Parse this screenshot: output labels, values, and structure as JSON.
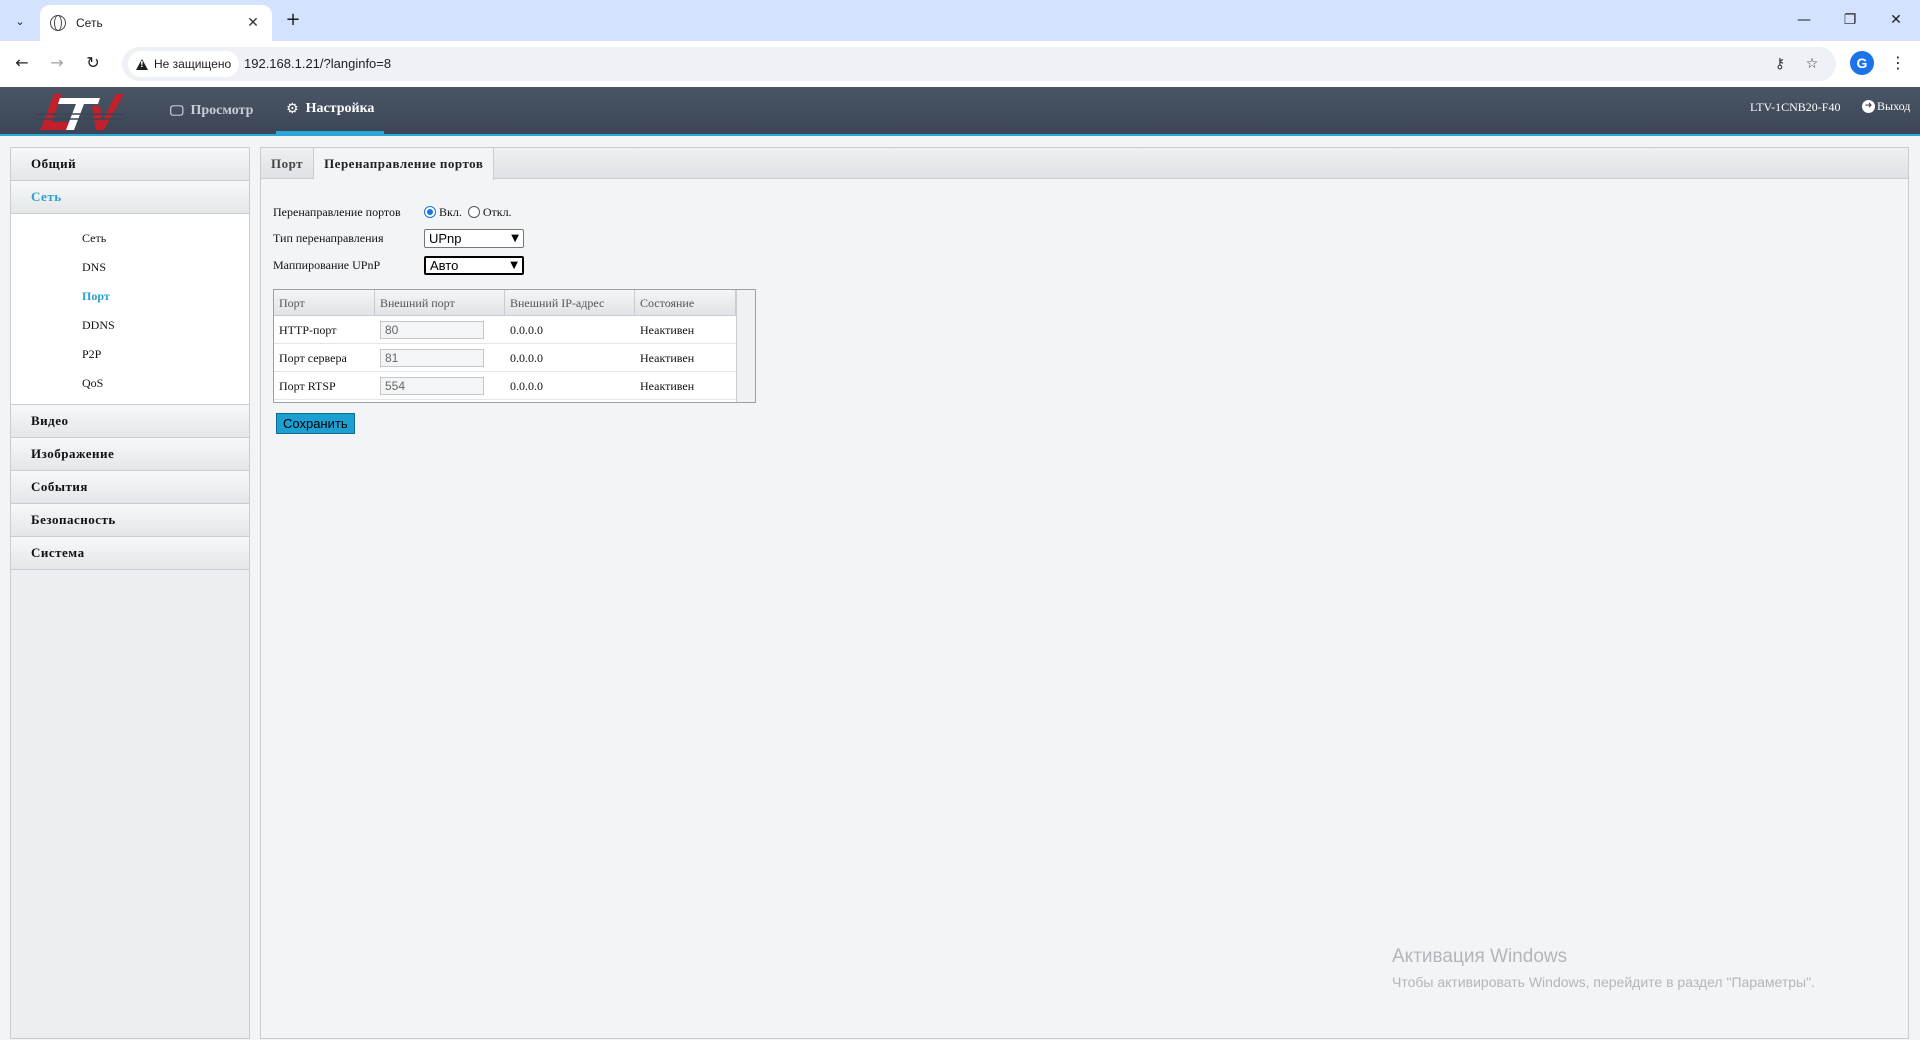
{
  "browser": {
    "tab_title": "Сеть",
    "security_label": "Не защищено",
    "url": "192.168.1.21/?langinfo=8",
    "profile_letter": "G"
  },
  "header": {
    "logo_text": "LTV",
    "nav": [
      {
        "label": "Просмотр",
        "icon": "monitor-icon"
      },
      {
        "label": "Настройка",
        "icon": "gear-icon"
      }
    ],
    "model": "LTV-1CNB20-F40",
    "logout_label": "Выход",
    "accent_color": "#2aa7d6"
  },
  "sidebar": {
    "groups": [
      {
        "label": "Общий"
      },
      {
        "label": "Сеть",
        "open": true
      },
      {
        "label": "Видео"
      },
      {
        "label": "Изображение"
      },
      {
        "label": "События"
      },
      {
        "label": "Безопасность"
      },
      {
        "label": "Система"
      }
    ],
    "sub_items": [
      {
        "label": "Сеть"
      },
      {
        "label": "DNS"
      },
      {
        "label": "Порт",
        "active": true
      },
      {
        "label": "DDNS"
      },
      {
        "label": "P2P"
      },
      {
        "label": "QoS"
      }
    ]
  },
  "content": {
    "tabs": [
      {
        "label": "Порт"
      },
      {
        "label": "Перенаправление портов",
        "active": true
      }
    ],
    "form": {
      "forwarding_label": "Перенаправление портов",
      "on_label": "Вкл.",
      "off_label": "Откл.",
      "selected": "on",
      "type_label": "Тип перенаправления",
      "type_value": "UPnp",
      "mapping_label": "Маппирование UPnP",
      "mapping_value": "Авто"
    },
    "table": {
      "headers": [
        "Порт",
        "Внешний порт",
        "Внешний IP-адрес",
        "Состояние"
      ],
      "rows": [
        {
          "port": "HTTP-порт",
          "external_port": "80",
          "external_ip": "0.0.0.0",
          "state": "Неактивен"
        },
        {
          "port": "Порт сервера",
          "external_port": "81",
          "external_ip": "0.0.0.0",
          "state": "Неактивен"
        },
        {
          "port": "Порт RTSP",
          "external_port": "554",
          "external_ip": "0.0.0.0",
          "state": "Неактивен"
        }
      ]
    },
    "save_label": "Сохранить"
  },
  "watermark": {
    "line1": "Активация Windows",
    "line2": "Чтобы активировать Windows, перейдите в раздел \"Параметры\"."
  }
}
